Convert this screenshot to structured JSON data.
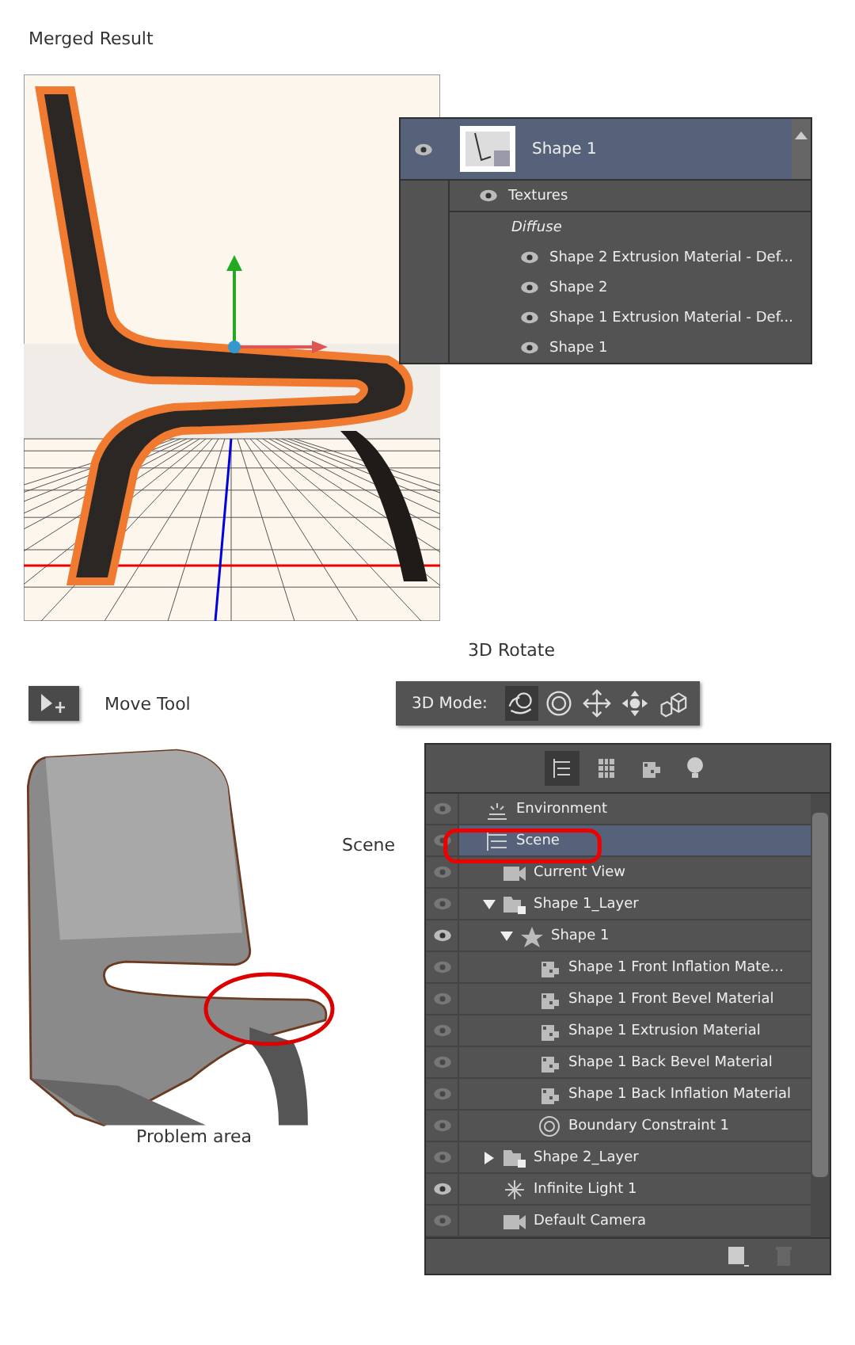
{
  "top_caption": "Merged Result",
  "textures_panel": {
    "layer": {
      "name": "Shape 1",
      "visible": true,
      "selected": true
    },
    "group": {
      "name": "Textures",
      "visible": true
    },
    "subgroup": "Diffuse",
    "items": [
      {
        "name": "Shape 2 Extrusion Material - Def...",
        "visible": true
      },
      {
        "name": "Shape 2",
        "visible": true
      },
      {
        "name": "Shape 1 Extrusion Material - Def...",
        "visible": true
      },
      {
        "name": "Shape 1",
        "visible": true
      }
    ]
  },
  "rotate_caption": "3D Rotate",
  "move_tool": {
    "label": "Move Tool"
  },
  "mode_bar": {
    "label": "3D Mode:",
    "tools": [
      {
        "kind": "rotate",
        "selected": true
      },
      {
        "kind": "roll",
        "selected": false
      },
      {
        "kind": "drag",
        "selected": false
      },
      {
        "kind": "slide",
        "selected": false
      },
      {
        "kind": "scale",
        "selected": false
      }
    ]
  },
  "scene_caption": "Scene",
  "problem_caption": "Problem area",
  "scene_panel": {
    "filters": [
      {
        "kind": "scene",
        "selected": true
      },
      {
        "kind": "mesh",
        "selected": false
      },
      {
        "kind": "material",
        "selected": false
      },
      {
        "kind": "light",
        "selected": false
      }
    ],
    "items": [
      {
        "name": "Environment",
        "kind": "environment",
        "visible": false,
        "selected": false
      },
      {
        "name": "Scene",
        "kind": "scene",
        "visible": false,
        "selected": true,
        "children": [
          {
            "name": "Current View",
            "kind": "camera",
            "visible": false,
            "selected": false
          },
          {
            "name": "Shape 1_Layer",
            "kind": "layer",
            "visible": false,
            "selected": false,
            "expanded": true,
            "children": [
              {
                "name": "Shape 1",
                "kind": "mesh",
                "visible": true,
                "selected": false,
                "expanded": true,
                "children": [
                  {
                    "name": "Shape 1 Front Inflation Mate...",
                    "kind": "material",
                    "visible": false,
                    "selected": false
                  },
                  {
                    "name": "Shape 1 Front Bevel Material",
                    "kind": "material",
                    "visible": false,
                    "selected": false
                  },
                  {
                    "name": "Shape 1 Extrusion Material",
                    "kind": "material",
                    "visible": false,
                    "selected": false
                  },
                  {
                    "name": "Shape 1 Back Bevel Material",
                    "kind": "material",
                    "visible": false,
                    "selected": false
                  },
                  {
                    "name": "Shape 1 Back Inflation Material",
                    "kind": "material",
                    "visible": false,
                    "selected": false
                  },
                  {
                    "name": "Boundary Constraint 1",
                    "kind": "constraint",
                    "visible": false,
                    "selected": false
                  }
                ]
              }
            ]
          },
          {
            "name": "Shape 2_Layer",
            "kind": "layer",
            "visible": false,
            "selected": false,
            "expanded": false
          },
          {
            "name": "Infinite Light 1",
            "kind": "light",
            "visible": true,
            "selected": false
          },
          {
            "name": "Default Camera",
            "kind": "camera",
            "visible": false,
            "selected": false
          }
        ]
      }
    ]
  }
}
